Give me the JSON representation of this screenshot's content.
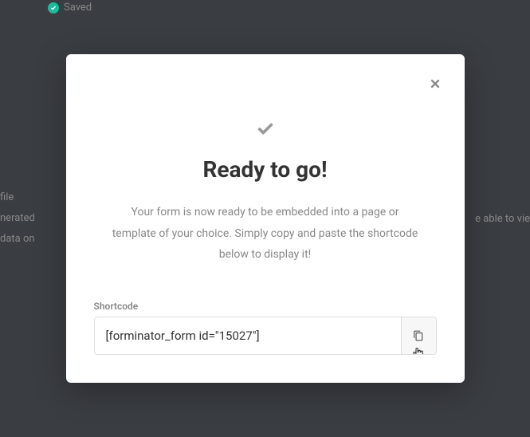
{
  "background": {
    "saved_label": "Saved",
    "left_lines": [
      "file",
      "nerated",
      "data on"
    ],
    "right_line": "e able to vie"
  },
  "modal": {
    "title": "Ready to go!",
    "description": "Your form is now ready to be embedded into a page or template of your choice. Simply copy and paste the shortcode below to display it!",
    "shortcode_label": "Shortcode",
    "shortcode_value": "[forminator_form id=\"15027\"]"
  }
}
